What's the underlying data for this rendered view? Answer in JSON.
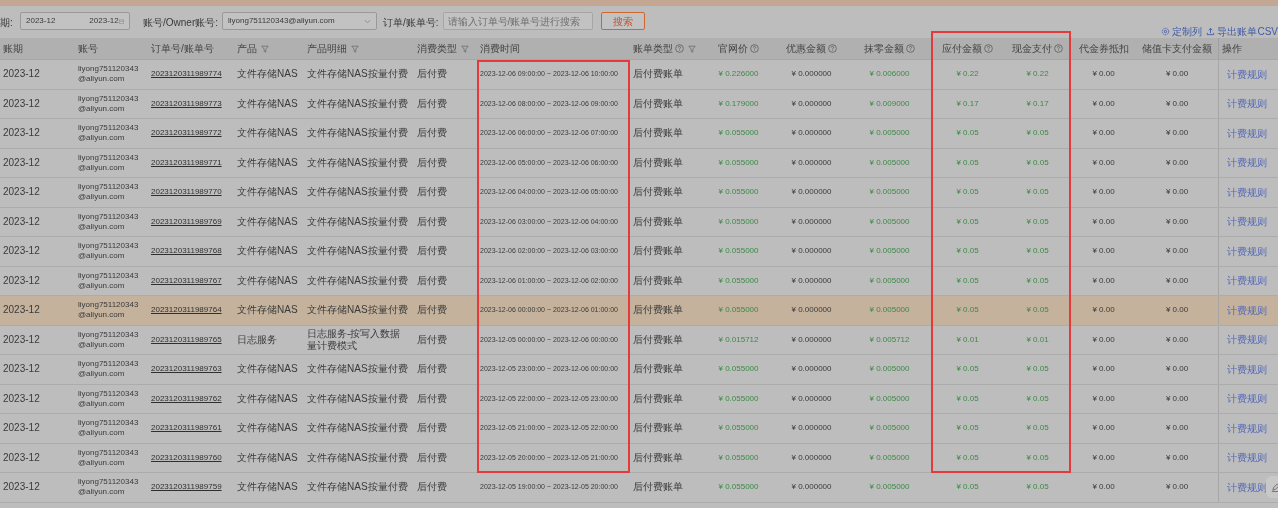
{
  "filters": {
    "period_label": "期:",
    "period_start": "2023-12",
    "period_end": "2023-12",
    "account_label": "账号/Owner账号:",
    "account_value": "liyong751120343@aliyun.com",
    "order_label": "订单/账单号:",
    "order_placeholder": "请输入订单号/账单号进行搜索",
    "search_button": "搜索"
  },
  "toolbar": {
    "customize": "定制列",
    "export": "导出账单CSV"
  },
  "columns": [
    {
      "label": "账期",
      "kind": "text",
      "filter": false,
      "help": false
    },
    {
      "label": "账号",
      "kind": "email",
      "filter": false,
      "help": false
    },
    {
      "label": "订单号/账单号",
      "kind": "link",
      "filter": false,
      "help": false
    },
    {
      "label": "产品",
      "kind": "text",
      "filter": true,
      "help": false
    },
    {
      "label": "产品明细",
      "kind": "text",
      "filter": true,
      "help": false
    },
    {
      "label": "消费类型",
      "kind": "text",
      "filter": true,
      "help": false
    },
    {
      "label": "消费时间",
      "kind": "time",
      "filter": false,
      "help": false
    },
    {
      "label": "账单类型",
      "kind": "text",
      "filter": true,
      "help": true
    },
    {
      "label": "官网价",
      "kind": "amount",
      "filter": false,
      "help": true
    },
    {
      "label": "优惠金额",
      "kind": "zero",
      "filter": false,
      "help": true
    },
    {
      "label": "抹零金额",
      "kind": "amount",
      "filter": false,
      "help": true
    },
    {
      "label": "应付金额",
      "kind": "amount",
      "filter": false,
      "help": true
    },
    {
      "label": "现金支付",
      "kind": "amount",
      "filter": false,
      "help": true
    },
    {
      "label": "代金券抵扣",
      "kind": "zero",
      "filter": false,
      "help": false
    },
    {
      "label": "储值卡支付金额",
      "kind": "zero",
      "filter": false,
      "help": false
    },
    {
      "label": "操作",
      "kind": "action",
      "filter": false,
      "help": false
    }
  ],
  "annotation_frames_shown": true,
  "rows": [
    {
      "selected": false,
      "cells": [
        "2023-12",
        "liyong751120343@aliyun.com",
        "2023120311989774",
        "文件存储NAS",
        "文件存储NAS按量付费",
        "后付费",
        "2023-12-06 09:00:00 ~ 2023-12-06 10:00:00",
        "后付费账单",
        "¥ 0.226000",
        "¥ 0.000000",
        "¥ 0.006000",
        "¥ 0.22",
        "¥ 0.22",
        "¥ 0.00",
        "¥ 0.00",
        "计费规则"
      ]
    },
    {
      "selected": false,
      "cells": [
        "2023-12",
        "liyong751120343@aliyun.com",
        "2023120311989773",
        "文件存储NAS",
        "文件存储NAS按量付费",
        "后付费",
        "2023-12-06 08:00:00 ~ 2023-12-06 09:00:00",
        "后付费账单",
        "¥ 0.179000",
        "¥ 0.000000",
        "¥ 0.009000",
        "¥ 0.17",
        "¥ 0.17",
        "¥ 0.00",
        "¥ 0.00",
        "计费规则"
      ]
    },
    {
      "selected": false,
      "cells": [
        "2023-12",
        "liyong751120343@aliyun.com",
        "2023120311989772",
        "文件存储NAS",
        "文件存储NAS按量付费",
        "后付费",
        "2023-12-06 06:00:00 ~ 2023-12-06 07:00:00",
        "后付费账单",
        "¥ 0.055000",
        "¥ 0.000000",
        "¥ 0.005000",
        "¥ 0.05",
        "¥ 0.05",
        "¥ 0.00",
        "¥ 0.00",
        "计费规则"
      ]
    },
    {
      "selected": false,
      "cells": [
        "2023-12",
        "liyong751120343@aliyun.com",
        "2023120311989771",
        "文件存储NAS",
        "文件存储NAS按量付费",
        "后付费",
        "2023-12-06 05:00:00 ~ 2023-12-06 06:00:00",
        "后付费账单",
        "¥ 0.055000",
        "¥ 0.000000",
        "¥ 0.005000",
        "¥ 0.05",
        "¥ 0.05",
        "¥ 0.00",
        "¥ 0.00",
        "计费规则"
      ]
    },
    {
      "selected": false,
      "cells": [
        "2023-12",
        "liyong751120343@aliyun.com",
        "2023120311989770",
        "文件存储NAS",
        "文件存储NAS按量付费",
        "后付费",
        "2023-12-06 04:00:00 ~ 2023-12-06 05:00:00",
        "后付费账单",
        "¥ 0.055000",
        "¥ 0.000000",
        "¥ 0.005000",
        "¥ 0.05",
        "¥ 0.05",
        "¥ 0.00",
        "¥ 0.00",
        "计费规则"
      ]
    },
    {
      "selected": false,
      "cells": [
        "2023-12",
        "liyong751120343@aliyun.com",
        "2023120311989769",
        "文件存储NAS",
        "文件存储NAS按量付费",
        "后付费",
        "2023-12-06 03:00:00 ~ 2023-12-06 04:00:00",
        "后付费账单",
        "¥ 0.055000",
        "¥ 0.000000",
        "¥ 0.005000",
        "¥ 0.05",
        "¥ 0.05",
        "¥ 0.00",
        "¥ 0.00",
        "计费规则"
      ]
    },
    {
      "selected": false,
      "cells": [
        "2023-12",
        "liyong751120343@aliyun.com",
        "2023120311989768",
        "文件存储NAS",
        "文件存储NAS按量付费",
        "后付费",
        "2023-12-06 02:00:00 ~ 2023-12-06 03:00:00",
        "后付费账单",
        "¥ 0.055000",
        "¥ 0.000000",
        "¥ 0.005000",
        "¥ 0.05",
        "¥ 0.05",
        "¥ 0.00",
        "¥ 0.00",
        "计费规则"
      ]
    },
    {
      "selected": false,
      "cells": [
        "2023-12",
        "liyong751120343@aliyun.com",
        "2023120311989767",
        "文件存储NAS",
        "文件存储NAS按量付费",
        "后付费",
        "2023-12-06 01:00:00 ~ 2023-12-06 02:00:00",
        "后付费账单",
        "¥ 0.055000",
        "¥ 0.000000",
        "¥ 0.005000",
        "¥ 0.05",
        "¥ 0.05",
        "¥ 0.00",
        "¥ 0.00",
        "计费规则"
      ]
    },
    {
      "selected": true,
      "cells": [
        "2023-12",
        "liyong751120343@aliyun.com",
        "2023120311989764",
        "文件存储NAS",
        "文件存储NAS按量付费",
        "后付费",
        "2023-12-06 00:00:00 ~ 2023-12-06 01:00:00",
        "后付费账单",
        "¥ 0.055000",
        "¥ 0.000000",
        "¥ 0.005000",
        "¥ 0.05",
        "¥ 0.05",
        "¥ 0.00",
        "¥ 0.00",
        "计费规则"
      ]
    },
    {
      "selected": false,
      "cells": [
        "2023-12",
        "liyong751120343@aliyun.com",
        "2023120311989765",
        "日志服务",
        "日志服务-按写入数据量计费模式",
        "后付费",
        "2023-12-05 00:00:00 ~ 2023-12-06 00:00:00",
        "后付费账单",
        "¥ 0.015712",
        "¥ 0.000000",
        "¥ 0.005712",
        "¥ 0.01",
        "¥ 0.01",
        "¥ 0.00",
        "¥ 0.00",
        "计费规则"
      ]
    },
    {
      "selected": false,
      "cells": [
        "2023-12",
        "liyong751120343@aliyun.com",
        "2023120311989763",
        "文件存储NAS",
        "文件存储NAS按量付费",
        "后付费",
        "2023-12-05 23:00:00 ~ 2023-12-06 00:00:00",
        "后付费账单",
        "¥ 0.055000",
        "¥ 0.000000",
        "¥ 0.005000",
        "¥ 0.05",
        "¥ 0.05",
        "¥ 0.00",
        "¥ 0.00",
        "计费规则"
      ]
    },
    {
      "selected": false,
      "cells": [
        "2023-12",
        "liyong751120343@aliyun.com",
        "2023120311989762",
        "文件存储NAS",
        "文件存储NAS按量付费",
        "后付费",
        "2023-12-05 22:00:00 ~ 2023-12-05 23:00:00",
        "后付费账单",
        "¥ 0.055000",
        "¥ 0.000000",
        "¥ 0.005000",
        "¥ 0.05",
        "¥ 0.05",
        "¥ 0.00",
        "¥ 0.00",
        "计费规则"
      ]
    },
    {
      "selected": false,
      "cells": [
        "2023-12",
        "liyong751120343@aliyun.com",
        "2023120311989761",
        "文件存储NAS",
        "文件存储NAS按量付费",
        "后付费",
        "2023-12-05 21:00:00 ~ 2023-12-05 22:00:00",
        "后付费账单",
        "¥ 0.055000",
        "¥ 0.000000",
        "¥ 0.005000",
        "¥ 0.05",
        "¥ 0.05",
        "¥ 0.00",
        "¥ 0.00",
        "计费规则"
      ]
    },
    {
      "selected": false,
      "cells": [
        "2023-12",
        "liyong751120343@aliyun.com",
        "2023120311989760",
        "文件存储NAS",
        "文件存储NAS按量付费",
        "后付费",
        "2023-12-05 20:00:00 ~ 2023-12-05 21:00:00",
        "后付费账单",
        "¥ 0.055000",
        "¥ 0.000000",
        "¥ 0.005000",
        "¥ 0.05",
        "¥ 0.05",
        "¥ 0.00",
        "¥ 0.00",
        "计费规则"
      ]
    },
    {
      "selected": false,
      "cells": [
        "2023-12",
        "liyong751120343@aliyun.com",
        "2023120311989759",
        "文件存储NAS",
        "文件存储NAS按量付费",
        "后付费",
        "2023-12-05 19:00:00 ~ 2023-12-05 20:00:00",
        "后付费账单",
        "¥ 0.055000",
        "¥ 0.000000",
        "¥ 0.005000",
        "¥ 0.05",
        "¥ 0.05",
        "¥ 0.00",
        "¥ 0.00",
        "计费规则"
      ]
    }
  ]
}
